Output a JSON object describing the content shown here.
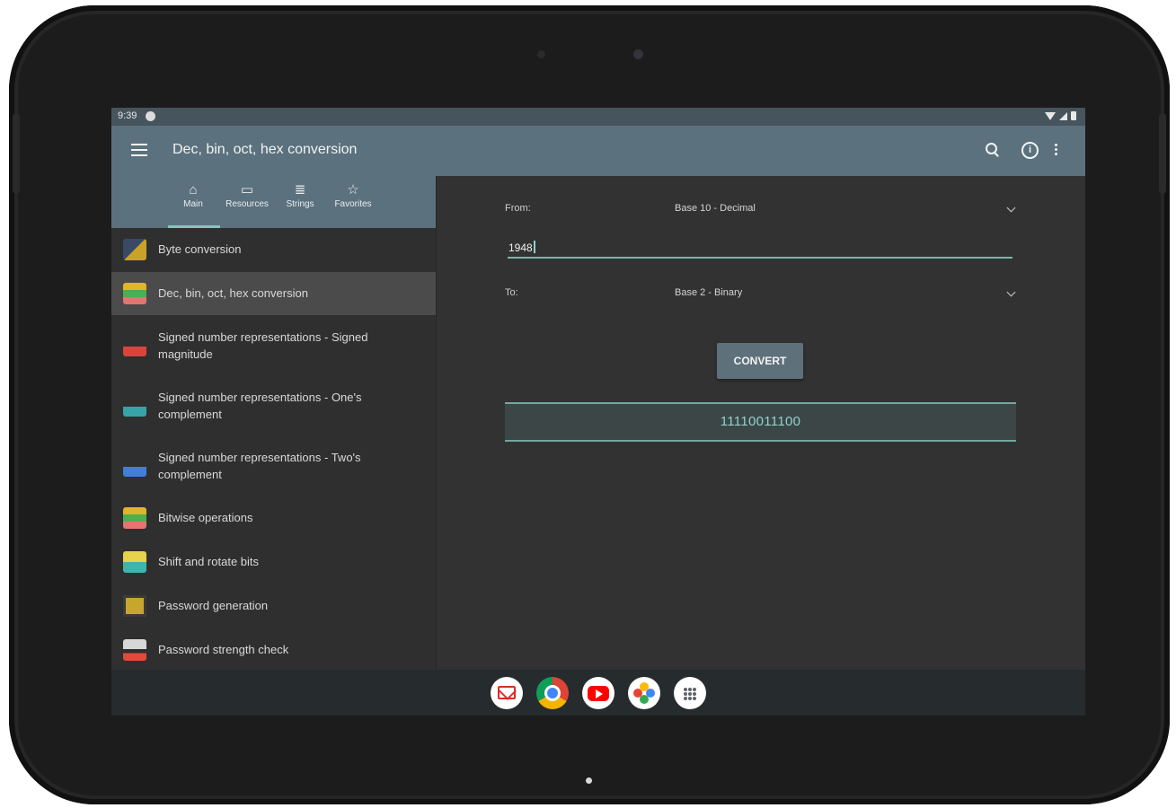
{
  "status_bar": {
    "time": "9:39"
  },
  "app_bar": {
    "title": "Dec, bin, oct, hex conversion"
  },
  "tabs": [
    {
      "label": "Main",
      "icon": "home-icon"
    },
    {
      "label": "Resources",
      "icon": "book-icon"
    },
    {
      "label": "Strings",
      "icon": "strings-icon"
    },
    {
      "label": "Favorites",
      "icon": "star-icon"
    }
  ],
  "nav_items": [
    {
      "label": "Byte conversion",
      "icon": "byte-conversion-icon"
    },
    {
      "label": "Dec, bin, oct, hex conversion",
      "icon": "number-conversion-icon",
      "selected": true
    },
    {
      "label": "Signed number representations - Signed magnitude",
      "icon": "signed-magnitude-icon"
    },
    {
      "label": "Signed number representations - One's complement",
      "icon": "ones-complement-icon"
    },
    {
      "label": "Signed number representations - Two's complement",
      "icon": "twos-complement-icon"
    },
    {
      "label": "Bitwise operations",
      "icon": "bitwise-icon"
    },
    {
      "label": "Shift and rotate bits",
      "icon": "shift-rotate-icon"
    },
    {
      "label": "Password generation",
      "icon": "password-generation-icon"
    },
    {
      "label": "Password strength check",
      "icon": "password-strength-icon"
    }
  ],
  "converter": {
    "from_label": "From:",
    "from_value": "Base 10 - Decimal",
    "input_value": "1948",
    "to_label": "To:",
    "to_value": "Base 2 - Binary",
    "convert_label": "CONVERT",
    "result": "11110011100"
  },
  "dock_apps": [
    "gmail-icon",
    "chrome-icon",
    "youtube-icon",
    "photos-icon",
    "app-drawer-icon"
  ],
  "colors": {
    "app_bar": "#5b717d",
    "accent": "#86c5bb",
    "result_text": "#8fd3c8",
    "background": "#2f2f2f"
  }
}
